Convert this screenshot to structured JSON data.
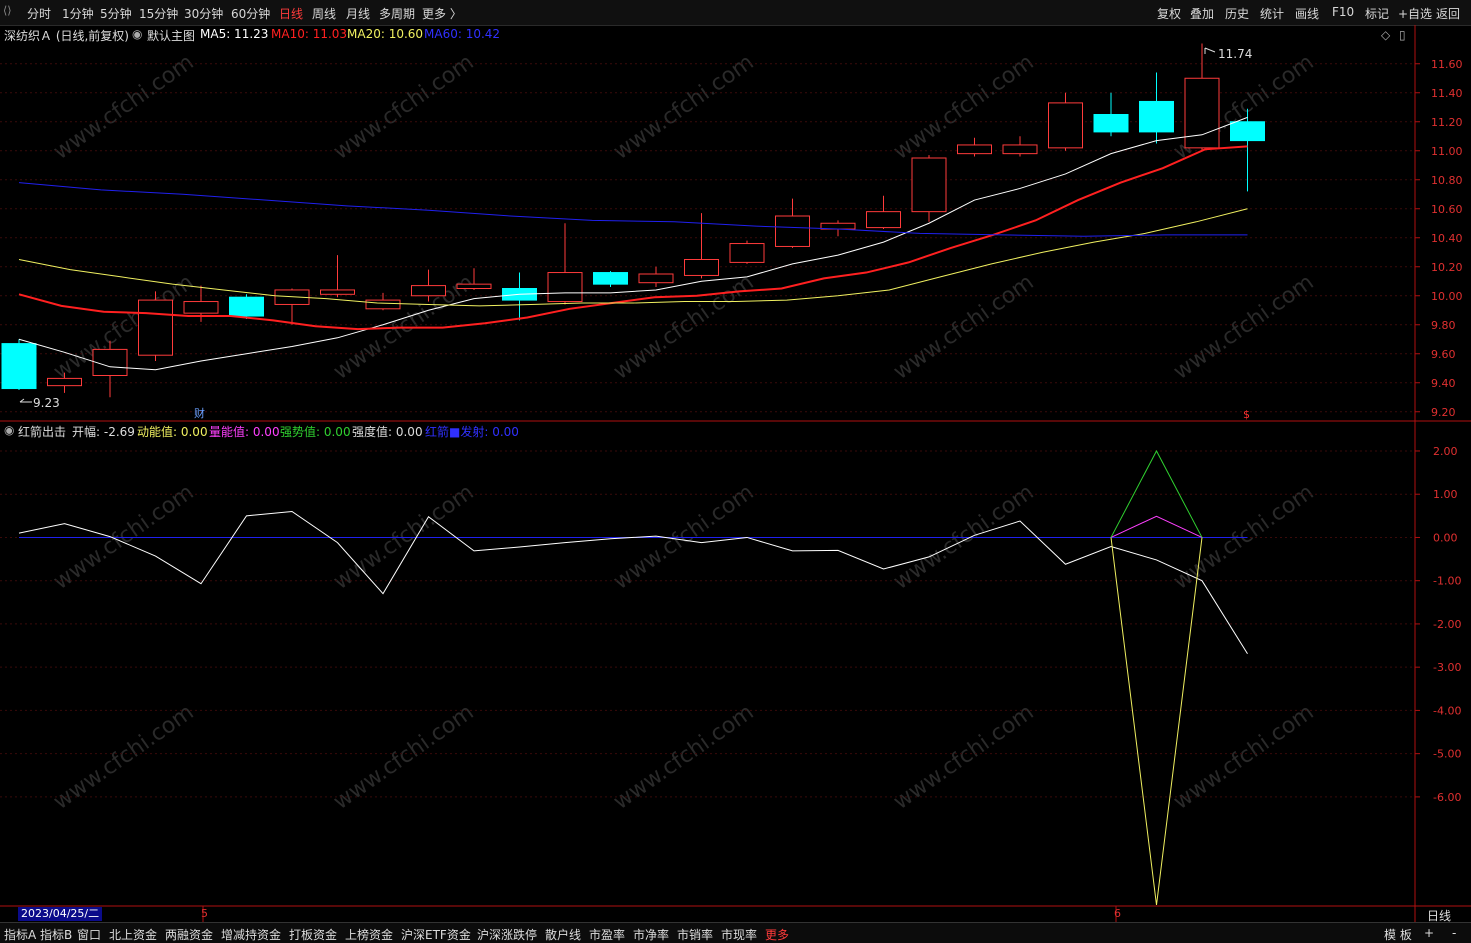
{
  "toolbar": {
    "periods": [
      "分时",
      "1分钟",
      "5分钟",
      "15分钟",
      "30分钟",
      "60分钟",
      "日线",
      "周线",
      "月线",
      "多周期",
      "更多 〉"
    ],
    "active_period": "日线",
    "right": [
      "复权",
      "叠加",
      "历史",
      "统计",
      "画线",
      "F10",
      "标记",
      "+自选",
      "返回"
    ]
  },
  "info": {
    "stock": "深纺织Ａ (日线,前复权)",
    "template": "默认主图",
    "ma5": "MA5: 11.23",
    "ma10": "MA10: 11.03",
    "ma20": "MA20: 10.60",
    "ma60": "MA60: 10.42"
  },
  "subinfo": {
    "name": "红箭出击",
    "kaifu": "开幅: -2.69",
    "dongneng": "动能值: 0.00",
    "liangneng": "量能值: 0.00",
    "qiangshi": "强势值: 0.00",
    "qiangdu": "强度值: 0.00",
    "hongjian": "红箭■发射: 0.00"
  },
  "main_axis": [
    "11.60",
    "11.40",
    "11.20",
    "11.00",
    "10.80",
    "10.60",
    "10.40",
    "10.20",
    "10.00",
    "9.80",
    "9.60",
    "9.40",
    "9.20"
  ],
  "sub_axis": [
    "2.00",
    "1.00",
    "0.00",
    "-1.00",
    "-2.00",
    "-3.00",
    "-4.00",
    "-5.00",
    "-6.00"
  ],
  "annotations": {
    "high": "11.74",
    "low": "9.23",
    "cai": "财",
    "marker": "$"
  },
  "date_label": "2023/04/25/二",
  "month_labels": [
    "5",
    "6"
  ],
  "period_label": "日线",
  "bottom_tabs": [
    "指标A",
    "指标B",
    "窗口",
    "北上资金",
    "两融资金",
    "增减持资金",
    "打板资金",
    "上榜资金",
    "沪深ETF资金",
    "沪深涨跌停",
    "散户线",
    "市盈率",
    "市净率",
    "市销率",
    "市现率",
    "更多"
  ],
  "bottom_right": [
    "模 板",
    "+",
    "-"
  ],
  "watermark": "www.cfchi.com",
  "chart_data": [
    {
      "type": "candlestick",
      "title": "深纺织Ａ (日线,前复权)",
      "ylim": [
        9.15,
        11.75
      ],
      "candles": [
        {
          "o": 9.67,
          "h": 9.7,
          "l": 9.35,
          "c": 9.36
        },
        {
          "o": 9.38,
          "h": 9.47,
          "l": 9.33,
          "c": 9.43
        },
        {
          "o": 9.45,
          "h": 9.69,
          "l": 9.3,
          "c": 9.63
        },
        {
          "o": 9.59,
          "h": 10.03,
          "l": 9.55,
          "c": 9.97
        },
        {
          "o": 9.88,
          "h": 10.07,
          "l": 9.82,
          "c": 9.96
        },
        {
          "o": 9.99,
          "h": 10.01,
          "l": 9.84,
          "c": 9.86
        },
        {
          "o": 9.94,
          "h": 10.05,
          "l": 9.8,
          "c": 10.04
        },
        {
          "o": 10.01,
          "h": 10.28,
          "l": 9.99,
          "c": 10.04
        },
        {
          "o": 9.91,
          "h": 10.02,
          "l": 9.9,
          "c": 9.97
        },
        {
          "o": 10.0,
          "h": 10.18,
          "l": 9.96,
          "c": 10.07
        },
        {
          "o": 10.05,
          "h": 10.19,
          "l": 10.04,
          "c": 10.08
        },
        {
          "o": 10.05,
          "h": 10.16,
          "l": 9.83,
          "c": 9.97
        },
        {
          "o": 9.96,
          "h": 10.5,
          "l": 9.94,
          "c": 10.16
        },
        {
          "o": 10.16,
          "h": 10.17,
          "l": 10.06,
          "c": 10.08
        },
        {
          "o": 10.09,
          "h": 10.2,
          "l": 10.06,
          "c": 10.15
        },
        {
          "o": 10.14,
          "h": 10.57,
          "l": 10.12,
          "c": 10.25
        },
        {
          "o": 10.23,
          "h": 10.38,
          "l": 10.22,
          "c": 10.36
        },
        {
          "o": 10.34,
          "h": 10.67,
          "l": 10.33,
          "c": 10.55
        },
        {
          "o": 10.46,
          "h": 10.52,
          "l": 10.41,
          "c": 10.5
        },
        {
          "o": 10.47,
          "h": 10.69,
          "l": 10.46,
          "c": 10.58
        },
        {
          "o": 10.58,
          "h": 10.97,
          "l": 10.51,
          "c": 10.95
        },
        {
          "o": 10.98,
          "h": 11.09,
          "l": 10.96,
          "c": 11.04
        },
        {
          "o": 10.98,
          "h": 11.1,
          "l": 10.96,
          "c": 11.04
        },
        {
          "o": 11.02,
          "h": 11.4,
          "l": 11.0,
          "c": 11.33
        },
        {
          "o": 11.25,
          "h": 11.4,
          "l": 11.1,
          "c": 11.13
        },
        {
          "o": 11.34,
          "h": 11.54,
          "l": 11.05,
          "c": 11.13
        },
        {
          "o": 11.02,
          "h": 11.74,
          "l": 11.0,
          "c": 11.5
        },
        {
          "o": 11.2,
          "h": 11.29,
          "l": 10.72,
          "c": 11.07
        }
      ],
      "series": [
        {
          "name": "MA5",
          "color": "#ffffff",
          "values": [
            9.7,
            9.61,
            9.51,
            9.49,
            9.55,
            9.6,
            9.65,
            9.71,
            9.8,
            9.9,
            9.98,
            10.01,
            10.02,
            10.02,
            10.04,
            10.1,
            10.13,
            10.22,
            10.28,
            10.37,
            10.5,
            10.66,
            10.74,
            10.84,
            10.98,
            11.07,
            11.11,
            11.23
          ]
        },
        {
          "name": "MA10",
          "color": "#ff2020",
          "values": [
            10.01,
            9.93,
            9.89,
            9.88,
            9.86,
            9.86,
            9.83,
            9.79,
            9.77,
            9.78,
            9.78,
            9.81,
            9.85,
            9.91,
            9.95,
            9.99,
            10.0,
            10.03,
            10.05,
            10.12,
            10.16,
            10.23,
            10.33,
            10.42,
            10.52,
            10.66,
            10.78,
            10.88,
            11.01,
            11.03
          ]
        },
        {
          "name": "MA20",
          "color": "#f0f060",
          "values": [
            10.25,
            10.18,
            10.13,
            10.08,
            10.04,
            10.0,
            9.98,
            9.95,
            9.94,
            9.93,
            9.94,
            9.95,
            9.95,
            9.96,
            9.96,
            9.97,
            10.0,
            10.04,
            10.13,
            10.22,
            10.3,
            10.37,
            10.43,
            10.51,
            10.6
          ]
        },
        {
          "name": "MA60",
          "color": "#2020ee",
          "values": [
            10.78,
            10.73,
            10.7,
            10.66,
            10.62,
            10.59,
            10.55,
            10.52,
            10.51,
            10.48,
            10.46,
            10.43,
            10.42,
            10.41,
            10.42,
            10.42
          ]
        }
      ]
    },
    {
      "type": "line",
      "title": "红箭出击",
      "ylim": [
        -8.5,
        2.3
      ],
      "series": [
        {
          "name": "开幅",
          "color": "#ffffff",
          "values": [
            0.1,
            0.32,
            0.02,
            -0.43,
            -1.07,
            0.5,
            0.6,
            -0.12,
            -1.3,
            0.48,
            -0.31,
            -0.22,
            -0.12,
            -0.03,
            0.03,
            -0.12,
            0.0,
            -0.31,
            -0.3,
            -0.73,
            -0.45,
            0.05,
            0.38,
            -0.62,
            -0.21,
            -0.52,
            -1.0,
            -2.69
          ]
        },
        {
          "name": "动能值",
          "color": "#f0f060",
          "values": [
            0,
            -8.5,
            0
          ]
        },
        {
          "name": "量能值",
          "color": "#ff40ff",
          "values": [
            0,
            0.49,
            0
          ]
        },
        {
          "name": "强势值",
          "color": "#30d030",
          "values": [
            0,
            2.0,
            0
          ]
        },
        {
          "name": "红箭■发射",
          "color": "#2020ee",
          "values": [
            0.0
          ]
        }
      ]
    }
  ]
}
